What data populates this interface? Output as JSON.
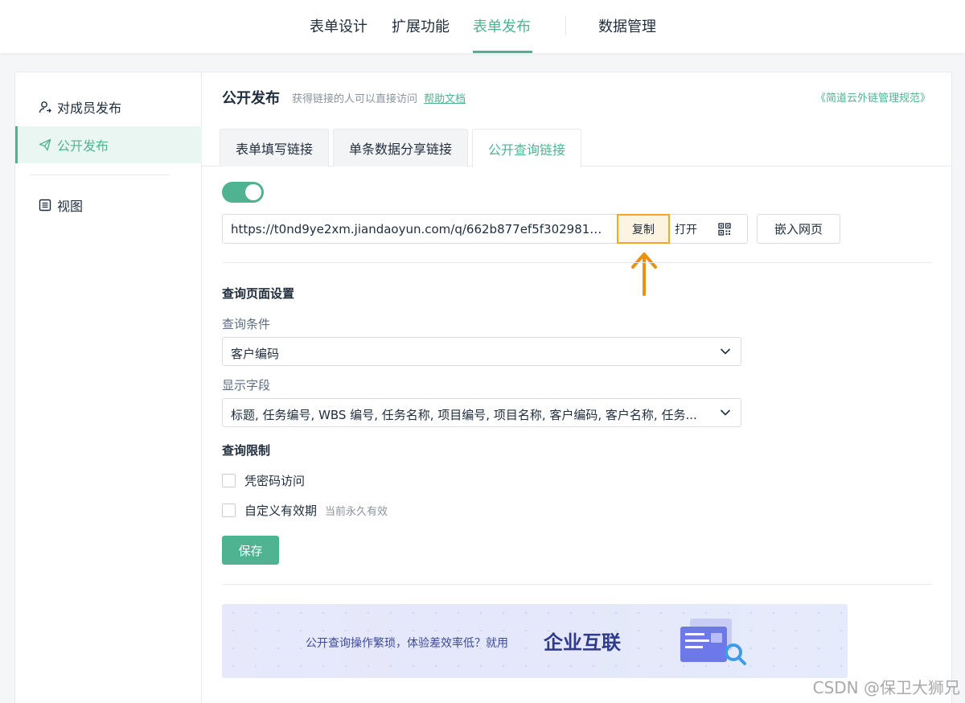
{
  "topnav": {
    "items": [
      {
        "label": "表单设计"
      },
      {
        "label": "扩展功能"
      },
      {
        "label": "表单发布",
        "active": true
      },
      {
        "label": "数据管理"
      }
    ]
  },
  "sidebar": {
    "items": [
      {
        "label": "对成员发布",
        "icon": "user-share-icon"
      },
      {
        "label": "公开发布",
        "icon": "send-icon",
        "active": true
      },
      {
        "label": "视图",
        "icon": "list-view-icon"
      }
    ]
  },
  "header": {
    "title": "公开发布",
    "desc": "获得链接的人可以直接访问",
    "help": "帮助文档",
    "right_link": "《简道云外链管理规范》"
  },
  "tabs": [
    {
      "label": "表单填写链接"
    },
    {
      "label": "单条数据分享链接"
    },
    {
      "label": "公开查询链接",
      "active": true
    }
  ],
  "link": {
    "url": "https://t0nd9ye2xm.jiandaoyun.com/q/662b877ef5f30298183...",
    "copy": "复制",
    "open": "打开",
    "embed": "嵌入网页"
  },
  "query_settings": {
    "title": "查询页面设置",
    "condition_label": "查询条件",
    "condition_value": "客户编码",
    "fields_label": "显示字段",
    "fields_value": "标题, 任务编号, WBS 编号, 任务名称, 项目编号, 项目名称, 客户编码, 客户名称, 任务..."
  },
  "limits": {
    "title": "查询限制",
    "password": "凭密码访问",
    "validity": "自定义有效期",
    "validity_note": "当前永久有效"
  },
  "save": "保存",
  "banner": {
    "text": "公开查询操作繁琐，体验差效率低？就用",
    "strong": "企业互联"
  },
  "watermark": "CSDN @保卫大狮兄",
  "colors": {
    "accent": "#4fb391",
    "highlight": "#f5a623"
  }
}
